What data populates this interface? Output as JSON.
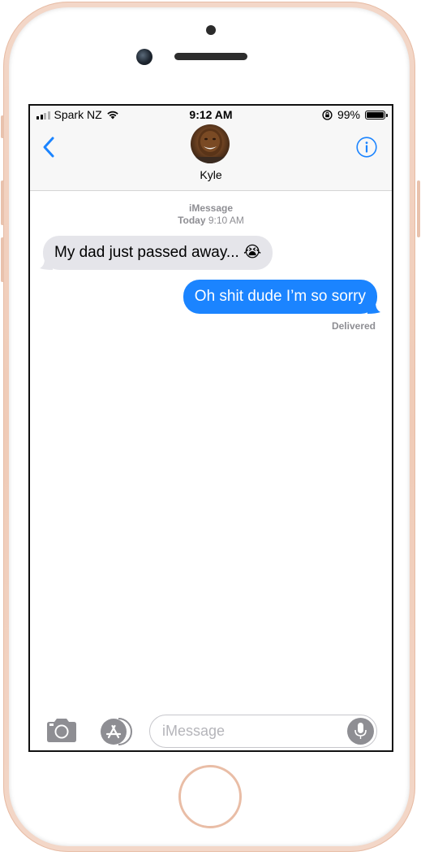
{
  "status_bar": {
    "carrier": "Spark NZ",
    "time": "9:12 AM",
    "battery_percent": "99%",
    "battery_level": 0.99,
    "icons": [
      "signal-bars-icon",
      "wifi-icon",
      "orientation-lock-icon",
      "battery-icon"
    ]
  },
  "header": {
    "contact_name": "Kyle",
    "back_icon": "chevron-left-icon",
    "info_icon": "info-icon"
  },
  "thread": {
    "service": "iMessage",
    "day": "Today",
    "time": "9:10 AM",
    "messages": [
      {
        "direction": "incoming",
        "text": "My dad just passed away... 😭"
      },
      {
        "direction": "outgoing",
        "text": "Oh shit dude I’m so sorry"
      }
    ],
    "receipt": "Delivered"
  },
  "input_bar": {
    "placeholder": "iMessage",
    "value": "",
    "icons": [
      "camera-icon",
      "app-store-icon",
      "microphone-icon"
    ]
  },
  "colors": {
    "accent": "#1b84ff",
    "incoming_bubble": "#e5e5ea",
    "meta_text": "#8e8e93",
    "phone_frame": "#f0cbb7"
  }
}
